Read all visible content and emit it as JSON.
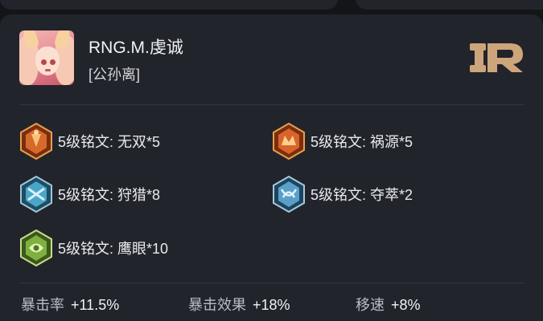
{
  "player": {
    "name": "RNG.M.虔诚",
    "hero": "[公孙离]"
  },
  "team_logo": {
    "icon": "rng-logo-icon",
    "color": "#cda57a"
  },
  "runes": [
    {
      "label": "5级铭文: 无双*5",
      "icon": "rune-wushuang-icon",
      "color": "#d76a2a"
    },
    {
      "label": "5级铭文: 祸源*5",
      "icon": "rune-huoyuan-icon",
      "color": "#d9642a"
    },
    {
      "label": "5级铭文: 狩猎*8",
      "icon": "rune-shoulie-icon",
      "color": "#4aa6c8"
    },
    {
      "label": "5级铭文: 夺萃*2",
      "icon": "rune-duocui-icon",
      "color": "#5a9fc7"
    },
    {
      "label": "5级铭文: 鹰眼*10",
      "icon": "rune-yingyan-icon",
      "color": "#7fb040"
    }
  ],
  "stats": [
    {
      "label": "暴击率",
      "value": "+11.5%"
    },
    {
      "label": "暴击效果",
      "value": "+18%"
    },
    {
      "label": "移速",
      "value": "+8%"
    }
  ]
}
